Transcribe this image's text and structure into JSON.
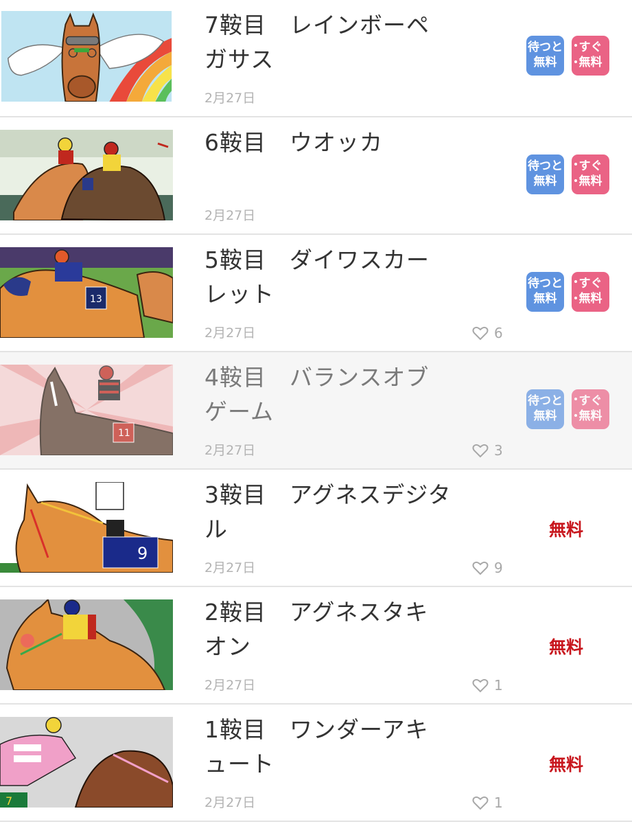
{
  "episodes": [
    {
      "number_title": "7鞍目　レインボーペガサス",
      "date": "2月27日",
      "likes": "",
      "pricing": "badges",
      "wait_free": [
        "待つと",
        "無料"
      ],
      "instant_free": [
        "すぐ",
        "無料"
      ],
      "thumbnail": "winged-horse-rainbow"
    },
    {
      "number_title": "6鞍目　ウオッカ",
      "date": "2月27日",
      "likes": "",
      "pricing": "badges",
      "wait_free": [
        "待つと",
        "無料"
      ],
      "instant_free": [
        "すぐ",
        "無料"
      ],
      "thumbnail": "two-horses-racing"
    },
    {
      "number_title": "5鞍目　ダイワスカーレット",
      "date": "2月27日",
      "likes": "6",
      "pricing": "badges",
      "wait_free": [
        "待つと",
        "無料"
      ],
      "instant_free": [
        "すぐ",
        "無料"
      ],
      "thumbnail": "horse-number-13"
    },
    {
      "number_title": "4鞍目　バランスオブゲーム",
      "date": "2月27日",
      "likes": "3",
      "pricing": "badges",
      "wait_free": [
        "待つと",
        "無料"
      ],
      "instant_free": [
        "すぐ",
        "無料"
      ],
      "thumbnail": "dark-horse-number-11"
    },
    {
      "number_title": "3鞍目　アグネスデジタル",
      "date": "2月27日",
      "likes": "9",
      "pricing": "free",
      "free_label": "無料",
      "thumbnail": "horse-number-9"
    },
    {
      "number_title": "2鞍目　アグネスタキオン",
      "date": "2月27日",
      "likes": "1",
      "pricing": "free",
      "free_label": "無料",
      "thumbnail": "chestnut-horse-jockey"
    },
    {
      "number_title": "1鞍目　ワンダーアキュート",
      "date": "2月27日",
      "likes": "1",
      "pricing": "free",
      "free_label": "無料",
      "thumbnail": "horse-number-7"
    }
  ],
  "colors": {
    "wait_badge": "#5f93e0",
    "instant_badge": "#ea6385",
    "free_text": "#c8161d"
  }
}
